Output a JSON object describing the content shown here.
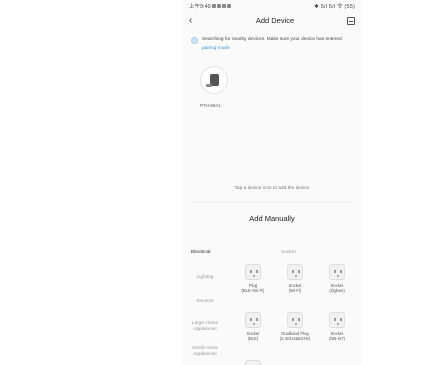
{
  "status_bar": {
    "time": "上午9:49",
    "right_indicators": "✱ 5ıl 5ıl 令 (55)"
  },
  "header": {
    "title": "Add Device",
    "back_icon": "chevron-left-icon",
    "scan_icon": "scan-icon"
  },
  "searching": {
    "text": "Searching for nearby devices. Make sure your device has entered ",
    "link": "pairing mode"
  },
  "found_device": {
    "name": "P7H-80A1"
  },
  "tap_hint": "Tap a device icon to add the device",
  "manual": {
    "title": "Add Manually"
  },
  "categories": [
    {
      "label": "Electrical",
      "active": true
    },
    {
      "label": "Lighting",
      "active": false
    },
    {
      "label": "Sensors",
      "active": false
    },
    {
      "label": "Large Home Appliances",
      "active": false
    },
    {
      "label": "Small Home Appliances",
      "active": false
    }
  ],
  "section": {
    "title": "Socket"
  },
  "tiles": [
    {
      "label_line1": "Plug",
      "label_line2": "(BLE+Wi-Fi)"
    },
    {
      "label_line1": "Socket",
      "label_line2": "(Wi-Fi)"
    },
    {
      "label_line1": "Socket",
      "label_line2": "(Zigbee)"
    },
    {
      "label_line1": "Socket",
      "label_line2": "(BLE)"
    },
    {
      "label_line1": "Dualband Plug",
      "label_line2": "(2.4GHz&5GHz)"
    },
    {
      "label_line1": "Socket",
      "label_line2": "(NB-IoT)"
    },
    {
      "label_line1": "",
      "label_line2": ""
    }
  ]
}
